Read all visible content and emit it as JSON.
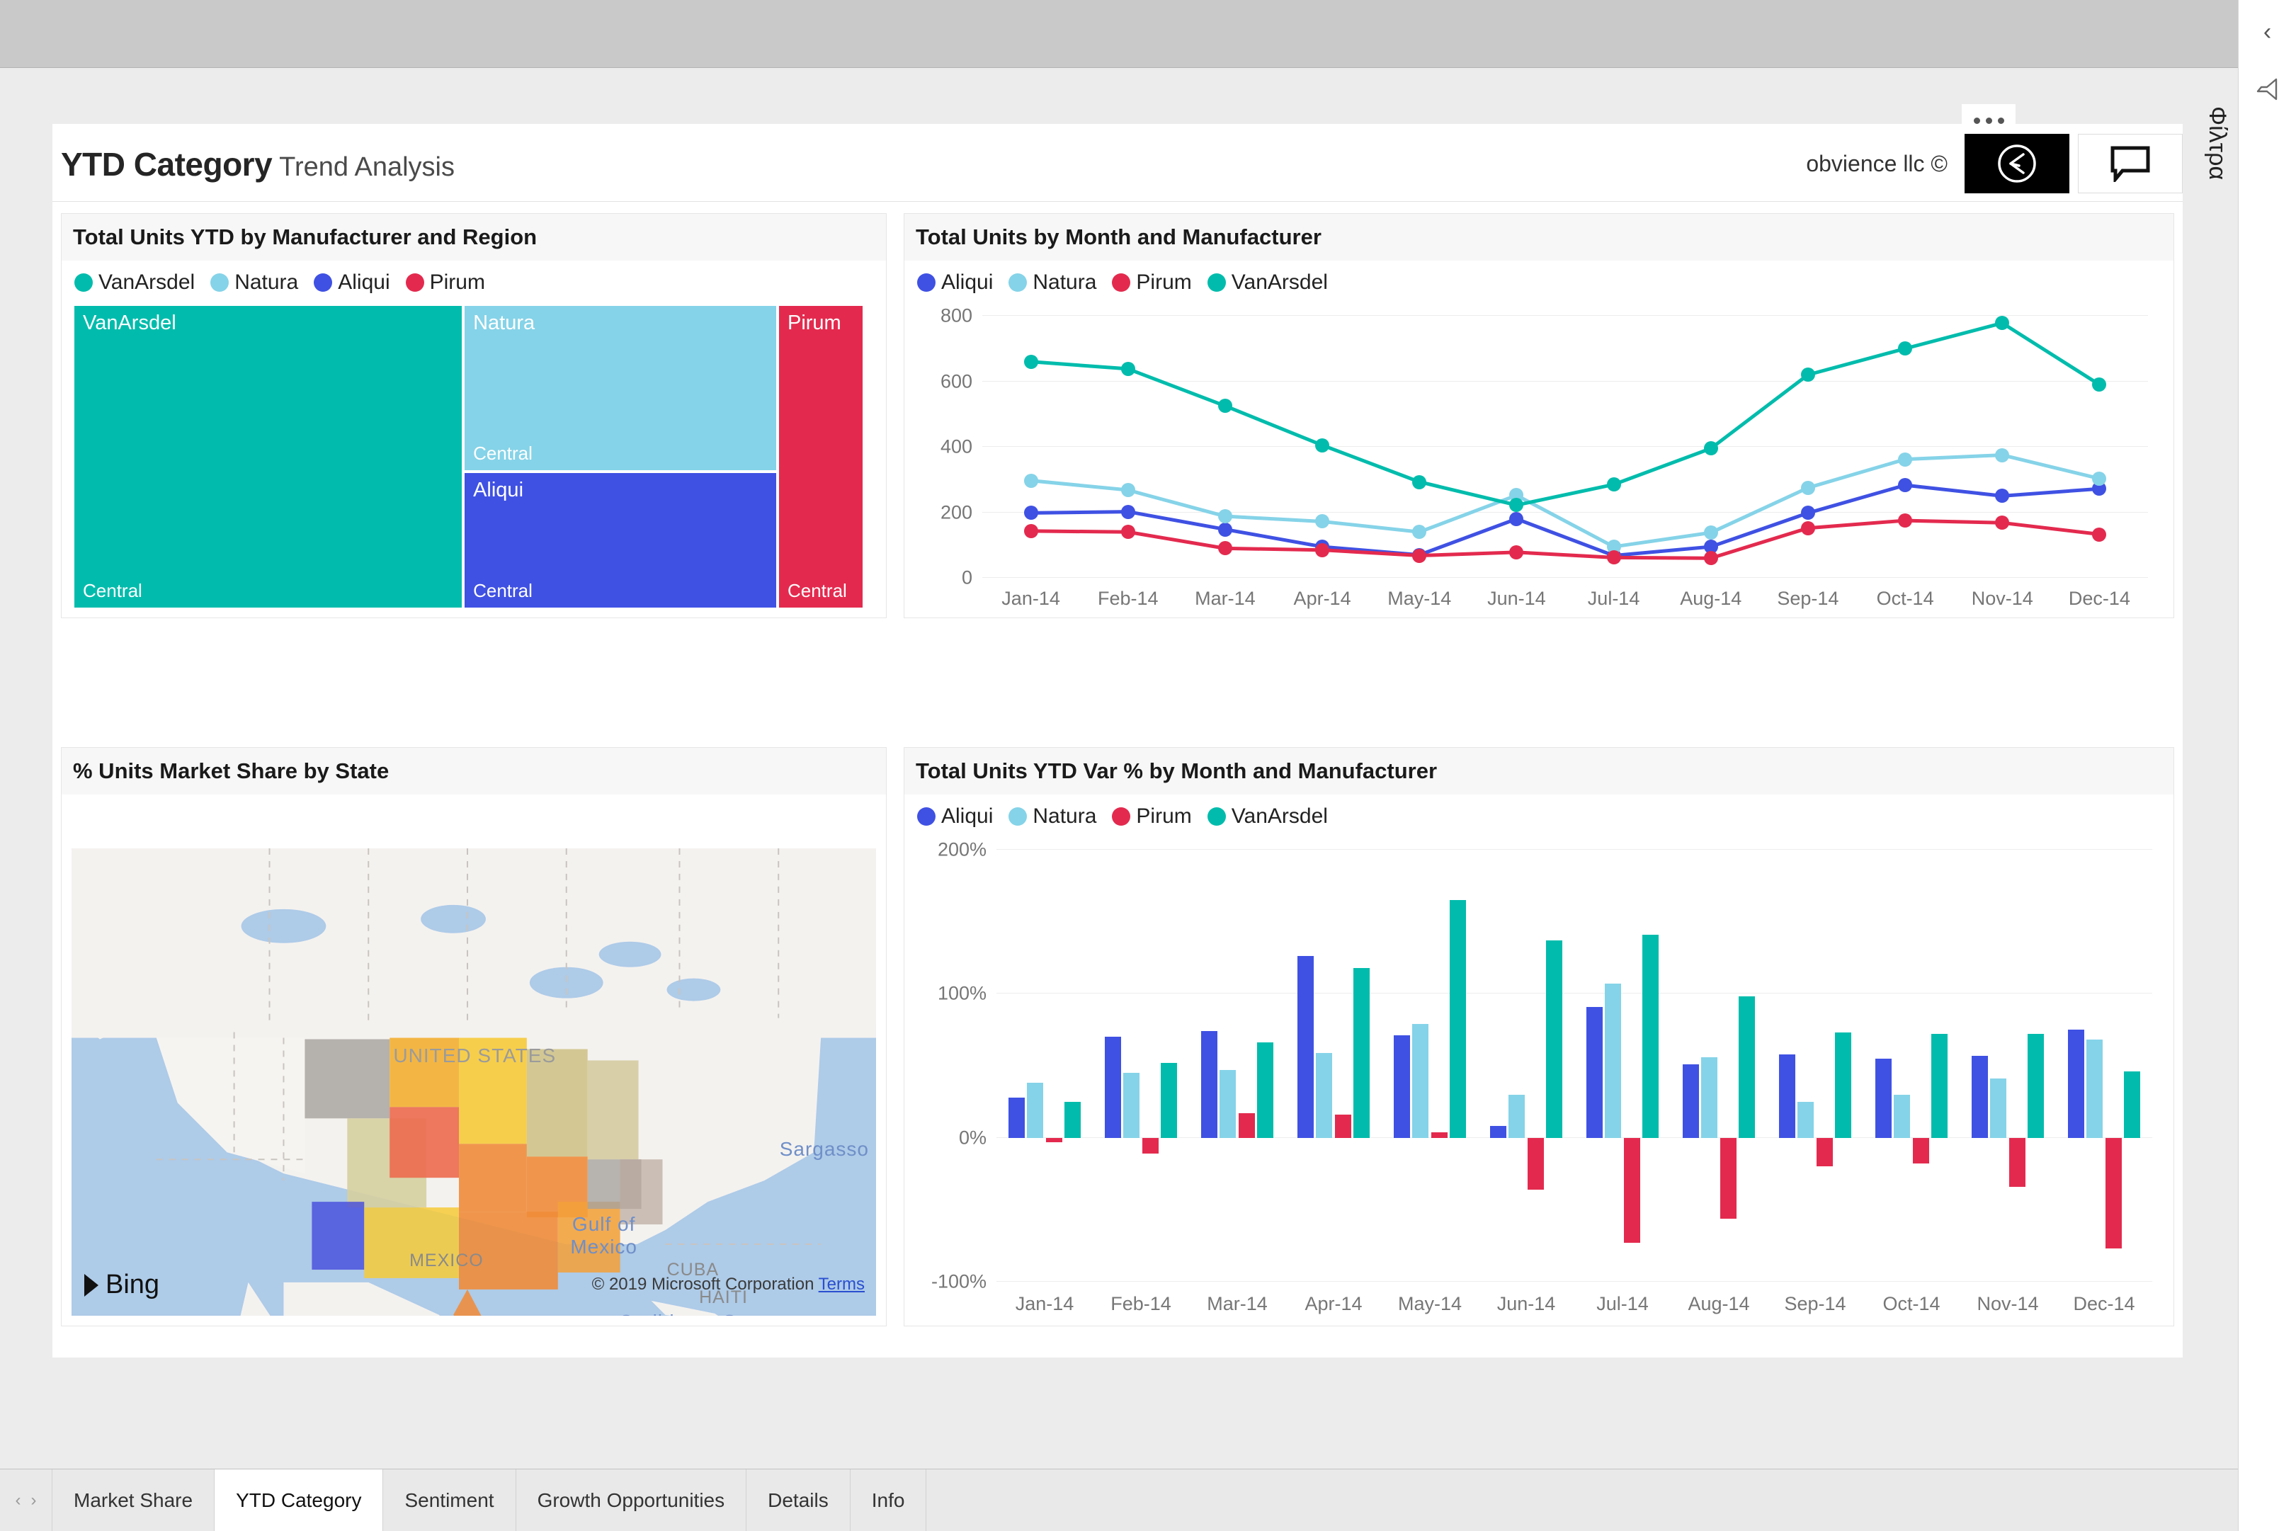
{
  "window": {
    "chrome_color": "#c9c9c9"
  },
  "header": {
    "title_main": "YTD Category",
    "title_sub": "Trend Analysis",
    "brand": "obvience llc ©",
    "ellipsis_label": "More options",
    "logo_name": "obvience-logo",
    "chat_name": "comments"
  },
  "filter_rail": {
    "collapse_glyph": "‹",
    "label": "Φίλτρα"
  },
  "colors": {
    "vanarsdel": "#01BCAC",
    "natura": "#85D3E8",
    "aliqui": "#3F51E3",
    "pirum": "#E32A4E",
    "grid": "#ededed",
    "axis_text": "#767676"
  },
  "visuals": {
    "treemap": {
      "title": "Total Units YTD by Manufacturer and Region",
      "legend": [
        "VanArsdel",
        "Natura",
        "Aliqui",
        "Pirum"
      ],
      "cells": [
        {
          "name": "VanArsdel",
          "region": "Central",
          "color": "#01BCAC"
        },
        {
          "name": "Natura",
          "region": "Central",
          "color": "#85D3E8"
        },
        {
          "name": "Aliqui",
          "region": "Central",
          "color": "#3F51E3"
        },
        {
          "name": "Pirum",
          "region": "Central",
          "color": "#E32A4E"
        }
      ]
    },
    "map": {
      "title": "% Units Market Share by State",
      "country_label": "UNITED STATES",
      "labels": [
        "MEXICO",
        "CUBA",
        "HAITI"
      ],
      "water_labels": [
        "Gulf of Mexico",
        "Sargasso",
        "Caribbean Sea"
      ],
      "bing_label": "Bing",
      "attribution": "© 2019 Microsoft Corporation",
      "terms_label": "Terms"
    },
    "line": {
      "title": "Total Units by Month and Manufacturer"
    },
    "bar": {
      "title": "Total Units YTD Var % by Month and Manufacturer"
    }
  },
  "tabs": {
    "prev_glyph": "‹",
    "next_glyph": "›",
    "items": [
      {
        "label": "Market Share",
        "active": false
      },
      {
        "label": "YTD Category",
        "active": true
      },
      {
        "label": "Sentiment",
        "active": false
      },
      {
        "label": "Growth Opportunities",
        "active": false
      },
      {
        "label": "Details",
        "active": false
      },
      {
        "label": "Info",
        "active": false
      }
    ]
  },
  "chart_data": [
    {
      "type": "treemap",
      "title": "Total Units YTD by Manufacturer and Region",
      "legend": [
        "VanArsdel",
        "Natura",
        "Aliqui",
        "Pirum"
      ],
      "nodes": [
        {
          "label": "VanArsdel",
          "sublabel": "Central",
          "color": "#01BCAC",
          "area_frac": 0.49
        },
        {
          "label": "Natura",
          "sublabel": "Central",
          "color": "#85D3E8",
          "area_frac": 0.2
        },
        {
          "label": "Aliqui",
          "sublabel": "Central",
          "color": "#3F51E3",
          "area_frac": 0.2
        },
        {
          "label": "Pirum",
          "sublabel": "Central",
          "color": "#E32A4E",
          "area_frac": 0.11
        }
      ]
    },
    {
      "type": "line",
      "title": "Total Units by Month and Manufacturer",
      "xlabel": "",
      "ylabel": "",
      "ylim": [
        0,
        800
      ],
      "yticks": [
        0,
        200,
        400,
        600,
        800
      ],
      "grid": true,
      "legend_position": "top-left",
      "categories": [
        "Jan-14",
        "Feb-14",
        "Mar-14",
        "Apr-14",
        "May-14",
        "Jun-14",
        "Jul-14",
        "Aug-14",
        "Sep-14",
        "Oct-14",
        "Nov-14",
        "Dec-14"
      ],
      "series": [
        {
          "name": "Aliqui",
          "color": "#3F51E3",
          "values": [
            198,
            202,
            148,
            95,
            70,
            180,
            68,
            95,
            198,
            283,
            250,
            272
          ]
        },
        {
          "name": "Natura",
          "color": "#85D3E8",
          "values": [
            297,
            268,
            188,
            172,
            140,
            252,
            95,
            138,
            275,
            362,
            375,
            303
          ]
        },
        {
          "name": "Pirum",
          "color": "#E32A4E",
          "values": [
            143,
            140,
            90,
            85,
            68,
            78,
            62,
            60,
            152,
            175,
            168,
            133
          ]
        },
        {
          "name": "VanArsdel",
          "color": "#01BCAC",
          "values": [
            660,
            638,
            525,
            405,
            293,
            222,
            285,
            395,
            620,
            700,
            778,
            590
          ]
        }
      ]
    },
    {
      "type": "bar",
      "title": "Total Units YTD Var % by Month and Manufacturer",
      "xlabel": "",
      "ylabel": "",
      "ylim": [
        -100,
        200
      ],
      "yticks": [
        -100,
        0,
        100,
        200
      ],
      "ytick_labels": [
        "-100%",
        "0%",
        "100%",
        "200%"
      ],
      "grid": true,
      "legend_position": "top-left",
      "categories": [
        "Jan-14",
        "Feb-14",
        "Mar-14",
        "Apr-14",
        "May-14",
        "Jun-14",
        "Jul-14",
        "Aug-14",
        "Sep-14",
        "Oct-14",
        "Nov-14",
        "Dec-14"
      ],
      "series": [
        {
          "name": "Aliqui",
          "color": "#3F51E3",
          "values": [
            28,
            70,
            74,
            126,
            71,
            8,
            91,
            51,
            58,
            55,
            57,
            75
          ]
        },
        {
          "name": "Natura",
          "color": "#85D3E8",
          "values": [
            38,
            45,
            47,
            59,
            79,
            30,
            107,
            56,
            25,
            30,
            41,
            68
          ]
        },
        {
          "name": "Pirum",
          "color": "#E32A4E",
          "values": [
            -3,
            -11,
            17,
            16,
            4,
            -36,
            -73,
            -56,
            -20,
            -18,
            -34,
            -77
          ]
        },
        {
          "name": "VanArsdel",
          "color": "#01BCAC",
          "values": [
            25,
            52,
            66,
            118,
            165,
            137,
            141,
            98,
            73,
            72,
            72,
            46
          ]
        }
      ]
    }
  ]
}
